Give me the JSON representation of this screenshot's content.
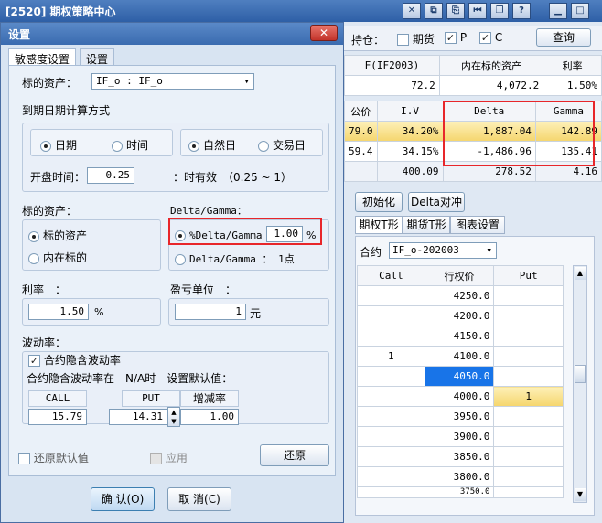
{
  "main_window": {
    "title": "[2520] 期权策略中心",
    "holding": {
      "label": "持仓：",
      "futures": "期货",
      "p": "P",
      "c": "C",
      "query": "查询"
    },
    "top_table": {
      "headers": [
        "F(IF2003)",
        "内在标的资产",
        "利率"
      ],
      "values": [
        "72.2",
        "4,072.2",
        "1.50%"
      ]
    },
    "greeks_table": {
      "headers": [
        "公价",
        "I.V",
        "Delta",
        "Gamma"
      ],
      "rows": [
        {
          "price": "79.0",
          "iv": "34.20%",
          "delta": "1,887.04",
          "gamma": "142.89"
        },
        {
          "price": "59.4",
          "iv": "34.15%",
          "delta": "-1,486.96",
          "gamma": "135.41"
        }
      ],
      "totals": [
        "400.09",
        "278.52",
        "4.16"
      ]
    },
    "buttons": {
      "init": "初始化",
      "hedge": "Delta对冲"
    },
    "tabs": [
      "期权T形",
      "期货T形",
      "图表设置"
    ],
    "contract": {
      "label": "合约",
      "value": "IF_o-202003"
    },
    "tshape": {
      "headers": [
        "Call",
        "行权价",
        "Put"
      ],
      "rows": [
        {
          "call": "",
          "strike": "4250.0",
          "put": ""
        },
        {
          "call": "",
          "strike": "4200.0",
          "put": ""
        },
        {
          "call": "",
          "strike": "4150.0",
          "put": ""
        },
        {
          "call": "1",
          "strike": "4100.0",
          "put": ""
        },
        {
          "call": "",
          "strike": "4050.0",
          "put": ""
        },
        {
          "call": "",
          "strike": "4000.0",
          "put": "1"
        },
        {
          "call": "",
          "strike": "3950.0",
          "put": ""
        },
        {
          "call": "",
          "strike": "3900.0",
          "put": ""
        },
        {
          "call": "",
          "strike": "3850.0",
          "put": ""
        },
        {
          "call": "",
          "strike": "3800.0",
          "put": ""
        },
        {
          "call": "",
          "strike": "3750.0",
          "put": ""
        }
      ]
    }
  },
  "dialog": {
    "title": "设置",
    "close": "✕",
    "tabs": [
      "敏感度设置",
      "设置"
    ],
    "underlying_label": "标的资产：",
    "underlying_value": "IF_o : IF_o",
    "expiry_method_label": "到期日期计算方式",
    "expiry": {
      "date": "日期",
      "time": "时间",
      "natural": "自然日",
      "trading": "交易日"
    },
    "open_time_label": "开盘时间：",
    "open_time_value": "0.25",
    "valid_text": "：时有效　（0.25 ~ 1）",
    "asset_section": "标的资产：",
    "asset_opts": [
      "标的资产",
      "内在标的"
    ],
    "dg_section": "Delta/Gamma：",
    "dg_pct_label": "%Delta/Gamma",
    "dg_pct_value": "1.00",
    "dg_pct_unit": "%",
    "dg_point_label": "Delta/Gamma ： 1点",
    "rate_label": "利率　：",
    "rate_value": "1.50",
    "rate_unit": "%",
    "pnl_label": "盈亏单位　：",
    "pnl_value": "1",
    "pnl_unit": "元",
    "vol_label": "波动率：",
    "vol_check": "合约隐含波动率",
    "vol_default_text": "合约隐含波动率在　N/A时　设置默认值：",
    "vol_cols": [
      "CALL",
      "PUT",
      "增减率"
    ],
    "vol_values": [
      "15.79",
      "14.31",
      "1.00"
    ],
    "restore_default": "还原默认值",
    "apply": "应用",
    "restore": "还原",
    "ok": "确 认(O)",
    "cancel": "取 消(C)"
  },
  "colors": {
    "highlight_red": "#e8262a",
    "selected_blue": "#1874e8",
    "row_yellow": "#f5d56c"
  }
}
